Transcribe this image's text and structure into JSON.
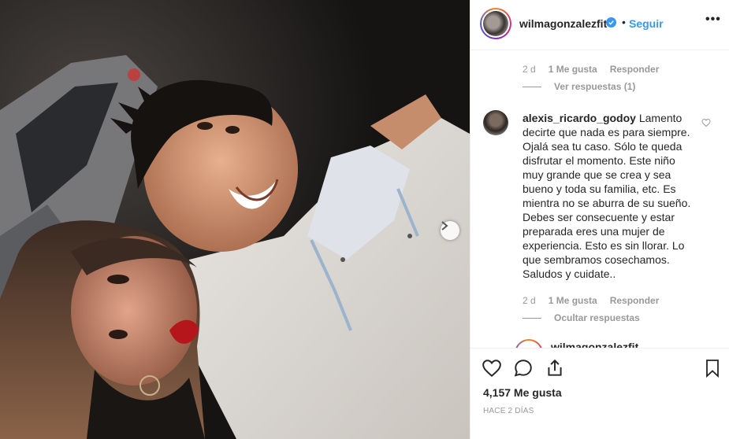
{
  "post": {
    "username": "wilmagonzalezfit",
    "separator": "•",
    "follow_label": "Seguir",
    "more_label": "•••",
    "likes": "4,157 Me gusta",
    "timestamp": "HACE 2 DÍAS"
  },
  "comments": [
    {
      "time": "2 d",
      "likes": "1 Me gusta",
      "reply_label": "Responder",
      "replies_toggle": "Ver respuestas (1)"
    },
    {
      "username": "alexis_ricardo_godoy",
      "text": "Lamento decirte que nada es para siempre. Ojalá sea tu caso. Sólo te queda disfrutar el momento. Este niño muy grande que se crea y sea bueno y toda su familia, etc. Es mientra no se aburra de su sueño. Debes ser consecuente y estar preparada eres una mujer de experiencia. Esto es sin llorar. Lo que sembramos cosechamos. Saludos y cuidate..",
      "time": "2 d",
      "likes": "1 Me gusta",
      "reply_label": "Responder",
      "replies_toggle": "Ocultar respuestas"
    }
  ],
  "partial_reply_username": "wilmagonzalezfit",
  "icons": {
    "verified": "verified-badge-icon",
    "like": "heart-icon",
    "comment": "comment-icon",
    "share": "share-icon",
    "save": "bookmark-icon",
    "next": "chevron-right-icon"
  },
  "colors": {
    "accent": "#3897f0",
    "muted": "#999999",
    "text": "#262626",
    "border": "#efefef"
  }
}
